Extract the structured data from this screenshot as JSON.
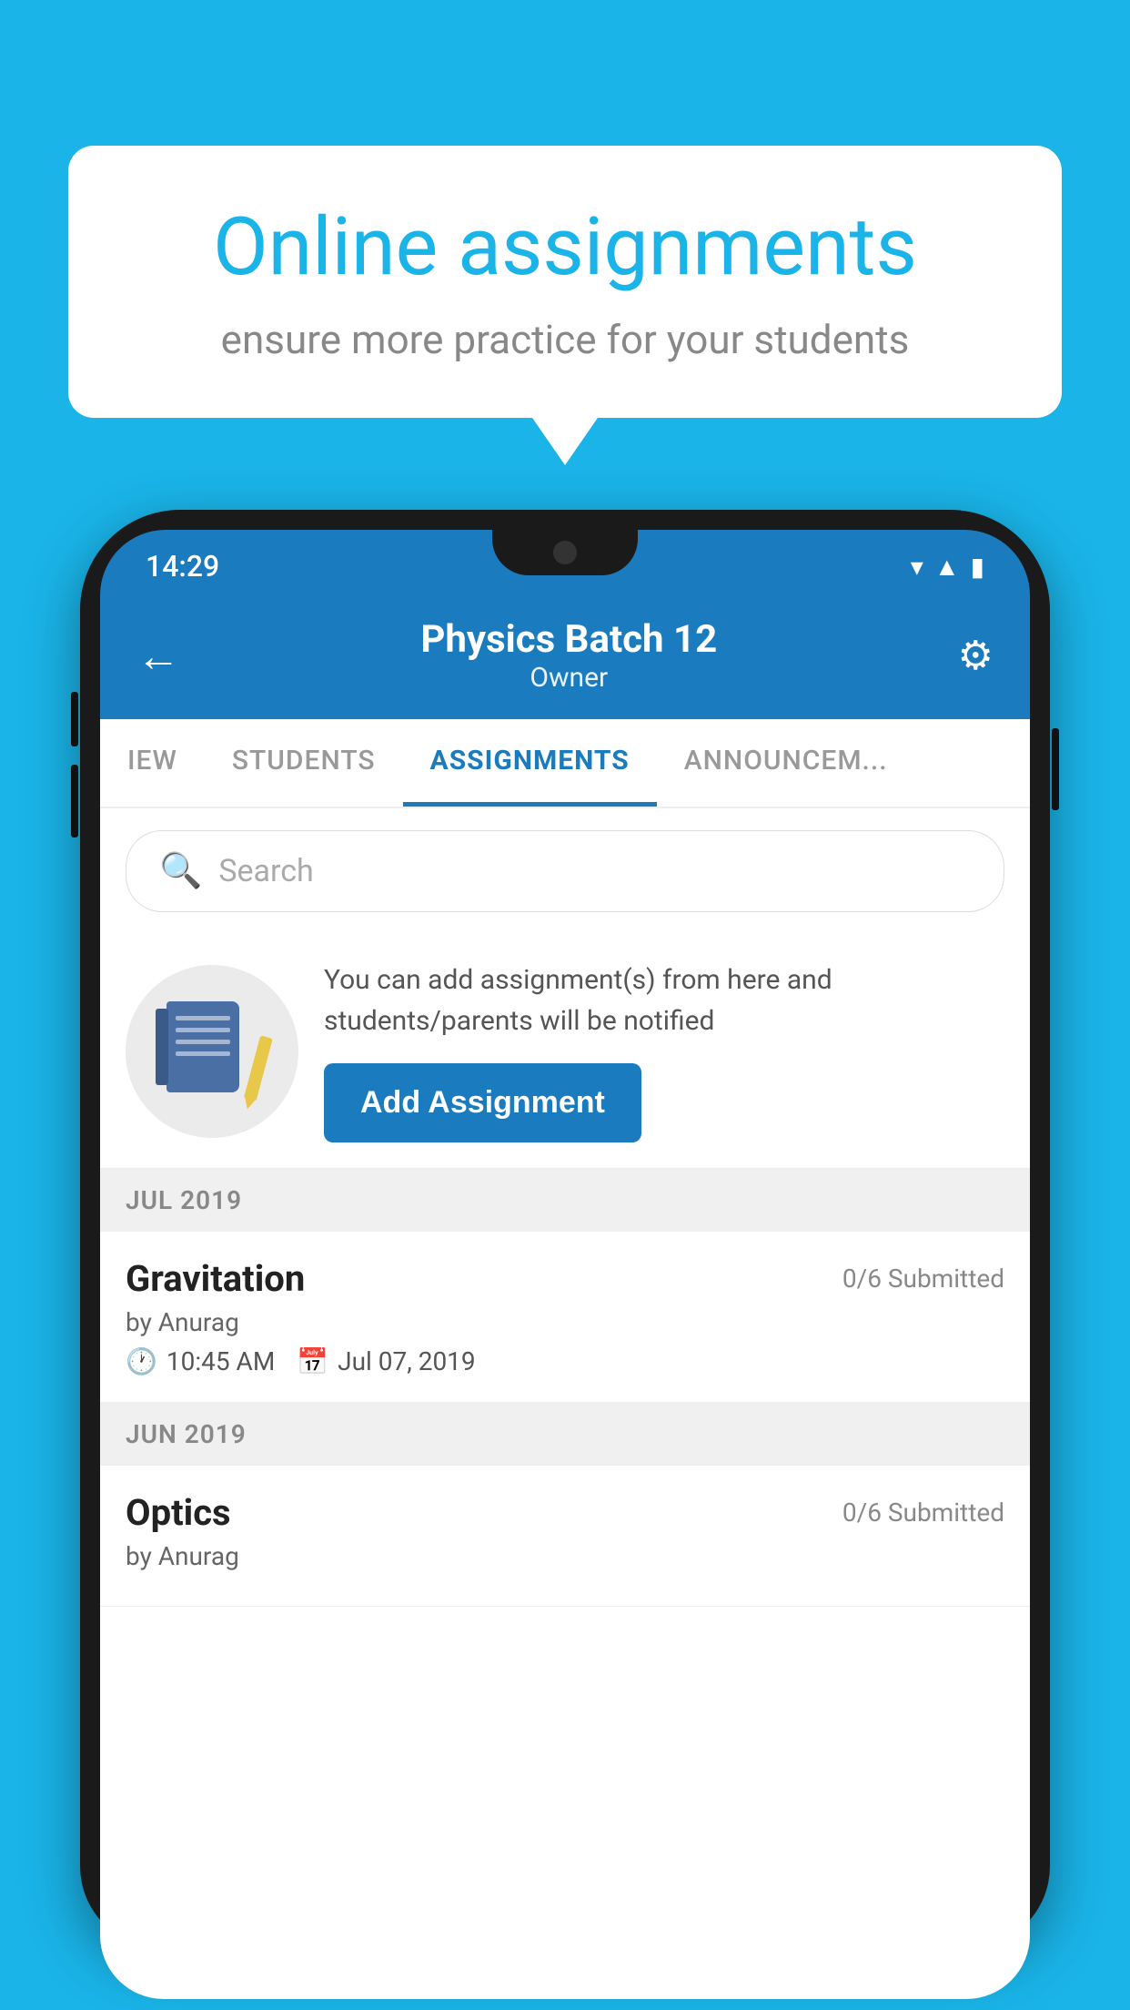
{
  "background_color": "#1ab4e8",
  "speech_bubble": {
    "title": "Online assignments",
    "subtitle": "ensure more practice for your students"
  },
  "phone": {
    "status_bar": {
      "time": "14:29",
      "icons": [
        "wifi",
        "signal",
        "battery"
      ]
    },
    "app_bar": {
      "title": "Physics Batch 12",
      "subtitle": "Owner",
      "back_label": "←",
      "settings_label": "⚙"
    },
    "tabs": [
      {
        "label": "IEW",
        "active": false
      },
      {
        "label": "STUDENTS",
        "active": false
      },
      {
        "label": "ASSIGNMENTS",
        "active": true
      },
      {
        "label": "ANNOUNCEMENTS",
        "active": false
      }
    ],
    "search": {
      "placeholder": "Search"
    },
    "promo": {
      "description": "You can add assignment(s) from here and students/parents will be notified",
      "button_label": "Add Assignment"
    },
    "month_sections": [
      {
        "month": "JUL 2019",
        "assignments": [
          {
            "name": "Gravitation",
            "submitted": "0/6 Submitted",
            "by": "by Anurag",
            "time": "10:45 AM",
            "date": "Jul 07, 2019"
          }
        ]
      },
      {
        "month": "JUN 2019",
        "assignments": [
          {
            "name": "Optics",
            "submitted": "0/6 Submitted",
            "by": "by Anurag",
            "time": "",
            "date": ""
          }
        ]
      }
    ]
  }
}
